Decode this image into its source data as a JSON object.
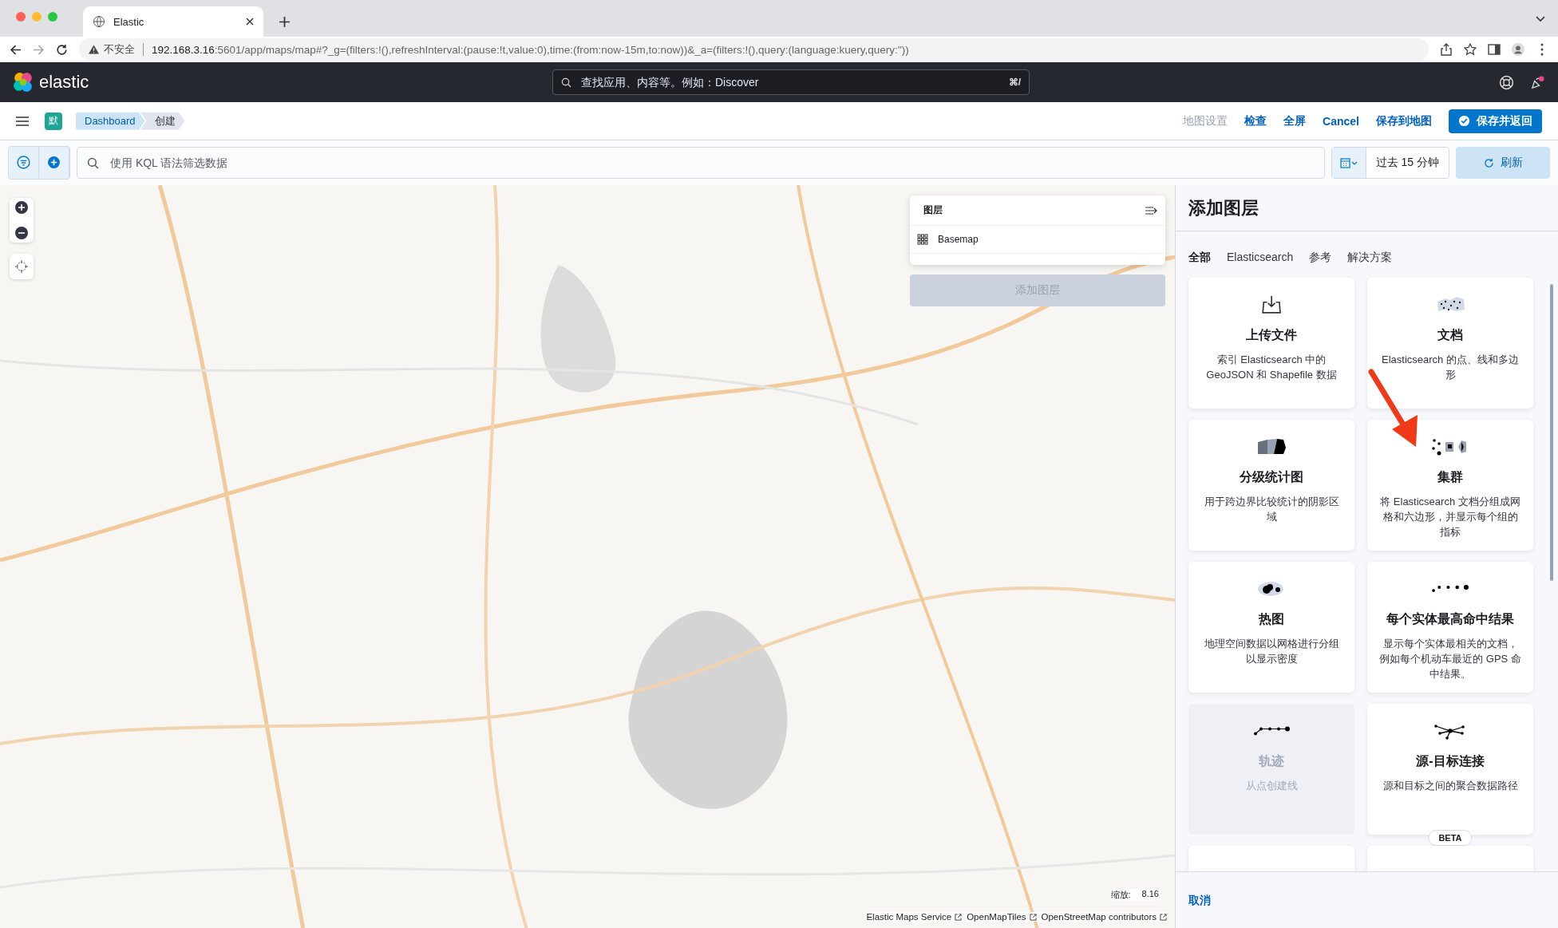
{
  "browser": {
    "tab_title": "Elastic",
    "security": "不安全",
    "url_host": "192.168.3.16",
    "url_rest": ":5601/app/maps/map#?_g=(filters:!(),refreshInterval:(pause:!t,value:0),time:(from:now-15m,to:now))&_a=(filters:!(),query:(language:kuery,query:''))"
  },
  "header": {
    "brand": "elastic",
    "search_placeholder": "查找应用、内容等。例如：Discover",
    "shortcut": "⌘/"
  },
  "toolbar": {
    "space": "默",
    "breadcrumbs": [
      {
        "label": "Dashboard",
        "selected": false
      },
      {
        "label": "创建",
        "selected": true
      }
    ],
    "actions": [
      {
        "label": "地图设置",
        "disabled": true
      },
      {
        "label": "检查",
        "disabled": false
      },
      {
        "label": "全屏",
        "disabled": false
      },
      {
        "label": "Cancel",
        "disabled": false
      },
      {
        "label": "保存到地图",
        "disabled": false
      }
    ],
    "primary": "保存并返回"
  },
  "filter_bar": {
    "placeholder": "使用 KQL 语法筛选数据",
    "time": "过去 15 分钟",
    "refresh": "刷新"
  },
  "map": {
    "layers_title": "图层",
    "layers": [
      {
        "name": "Basemap"
      }
    ],
    "add_layer": {
      "label": "添加图层",
      "disabled": true
    },
    "zoom_label": "缩放:",
    "zoom_value": "8.16",
    "attribution": [
      "Elastic Maps Service",
      "OpenMapTiles",
      "OpenStreetMap contributors"
    ]
  },
  "panel": {
    "title": "添加图层",
    "tabs": [
      {
        "label": "全部",
        "selected": true
      },
      {
        "label": "Elasticsearch",
        "selected": false
      },
      {
        "label": "参考",
        "selected": false
      },
      {
        "label": "解决方案",
        "selected": false
      }
    ],
    "cards": [
      {
        "kind": "upload",
        "title": "上传文件",
        "description": "索引 Elasticsearch 中的 GeoJSON 和 Shapefile 数据",
        "disabled": false
      },
      {
        "kind": "documents",
        "title": "文档",
        "description": "Elasticsearch 的点、线和多边形",
        "disabled": false
      },
      {
        "kind": "choropleth",
        "title": "分级统计图",
        "description": "用于跨边界比较统计的阴影区域",
        "disabled": false
      },
      {
        "kind": "clusters",
        "title": "集群",
        "description": "将 Elasticsearch 文档分组成网格和六边形，并显示每个组的指标",
        "disabled": false
      },
      {
        "kind": "heatmap",
        "title": "热图",
        "description": "地理空间数据以网格进行分组以显示密度",
        "disabled": false
      },
      {
        "kind": "tophits",
        "title": "每个实体最高命中结果",
        "description": "显示每个实体最相关的文档，例如每个机动车最近的 GPS 命中结果。",
        "disabled": false
      },
      {
        "kind": "tracks",
        "title": "轨迹",
        "description": "从点创建线",
        "disabled": true
      },
      {
        "kind": "connections",
        "title": "源-目标连接",
        "description": "源和目标之间的聚合数据路径",
        "disabled": false
      }
    ],
    "partial_cards": [
      {
        "kind": "plain"
      },
      {
        "kind": "beta",
        "badge": "BETA"
      }
    ],
    "cancel": "取消"
  }
}
